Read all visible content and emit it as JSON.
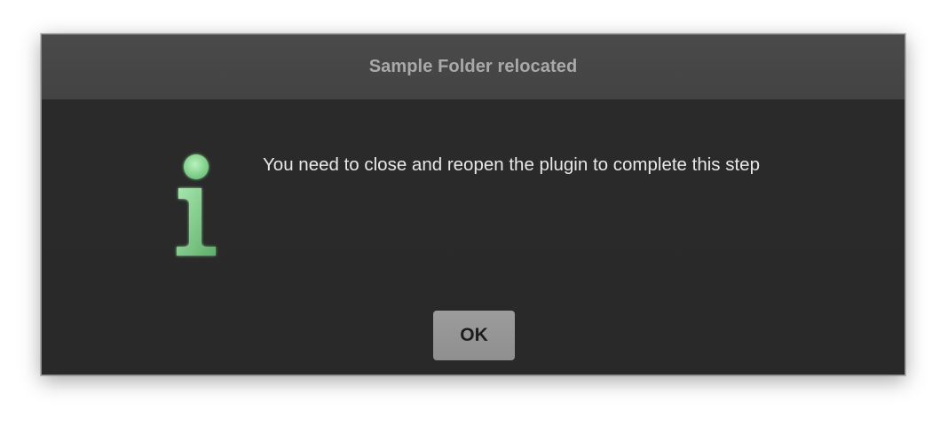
{
  "dialog": {
    "title": "Sample Folder relocated",
    "message": "You need to close and reopen the plugin to complete this step",
    "icon": "info-icon",
    "ok_label": "OK"
  },
  "colors": {
    "title_bar": "#474747",
    "body": "#2a2a2a",
    "title_text": "#a9a9a9",
    "message_text": "#e8e8e8",
    "button": "#969696",
    "icon_green": "#7fcf8a"
  }
}
